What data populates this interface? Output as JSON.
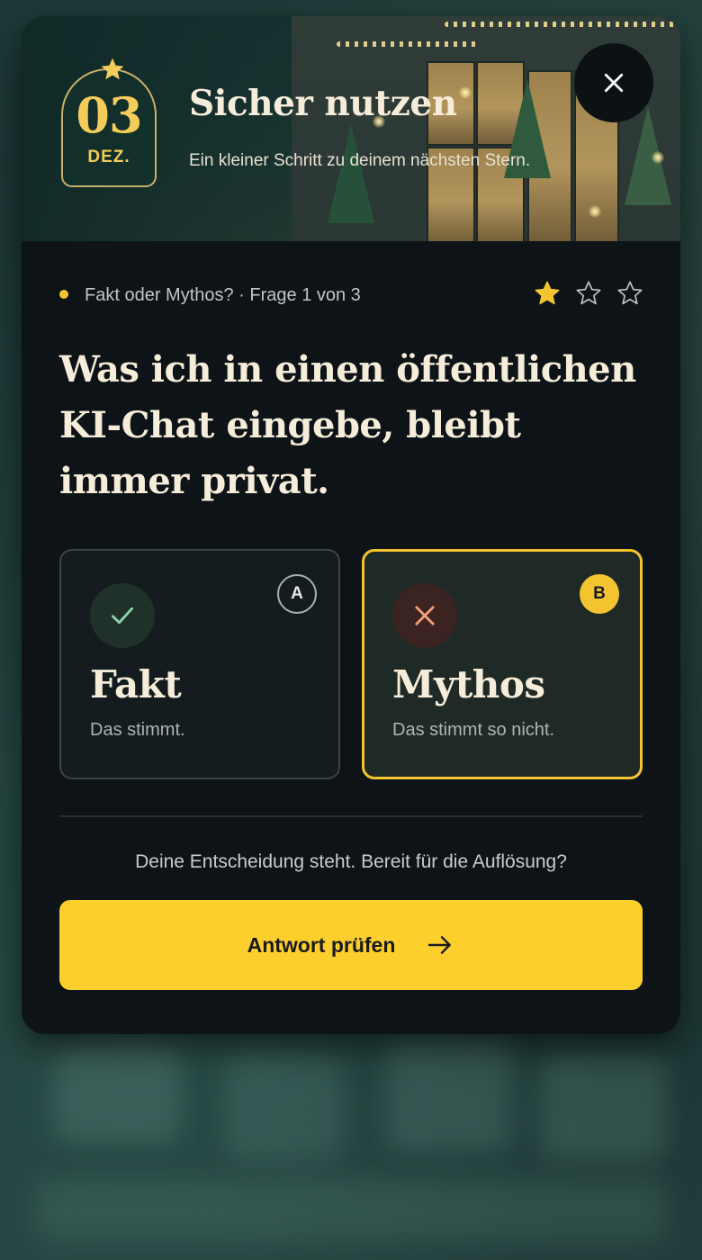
{
  "colors": {
    "accent": "#fccf2d",
    "star_filled": "#f4c430",
    "panel_background": "#0d1316",
    "selected_border": "#f4c430"
  },
  "header": {
    "date": {
      "day": "03",
      "month": "DEZ.",
      "icon": "star-icon"
    },
    "title": "Sicher nutzen",
    "subtitle": "Ein kleiner Schritt zu deinem nächsten Stern.",
    "close_icon": "close-icon"
  },
  "progress": {
    "label": "Fakt oder Mythos? · Frage 1 von 3",
    "current_question": 1,
    "total_questions": 3,
    "stars": [
      {
        "icon": "star-icon",
        "filled": true
      },
      {
        "icon": "star-icon",
        "filled": false
      },
      {
        "icon": "star-icon",
        "filled": false
      }
    ]
  },
  "question": {
    "text": "Was ich in einen öffentlichen KI-Chat eingebe, bleibt immer privat."
  },
  "options": [
    {
      "letter": "A",
      "title": "Fakt",
      "description": "Das stimmt.",
      "icon": "check-icon",
      "selected": false
    },
    {
      "letter": "B",
      "title": "Mythos",
      "description": "Das stimmt so nicht.",
      "icon": "cross-icon",
      "selected": true
    }
  ],
  "footer": {
    "status": "Deine Entscheidung steht. Bereit für die Auflösung?",
    "submit_label": "Antwort prüfen",
    "submit_icon": "arrow-right-icon"
  }
}
